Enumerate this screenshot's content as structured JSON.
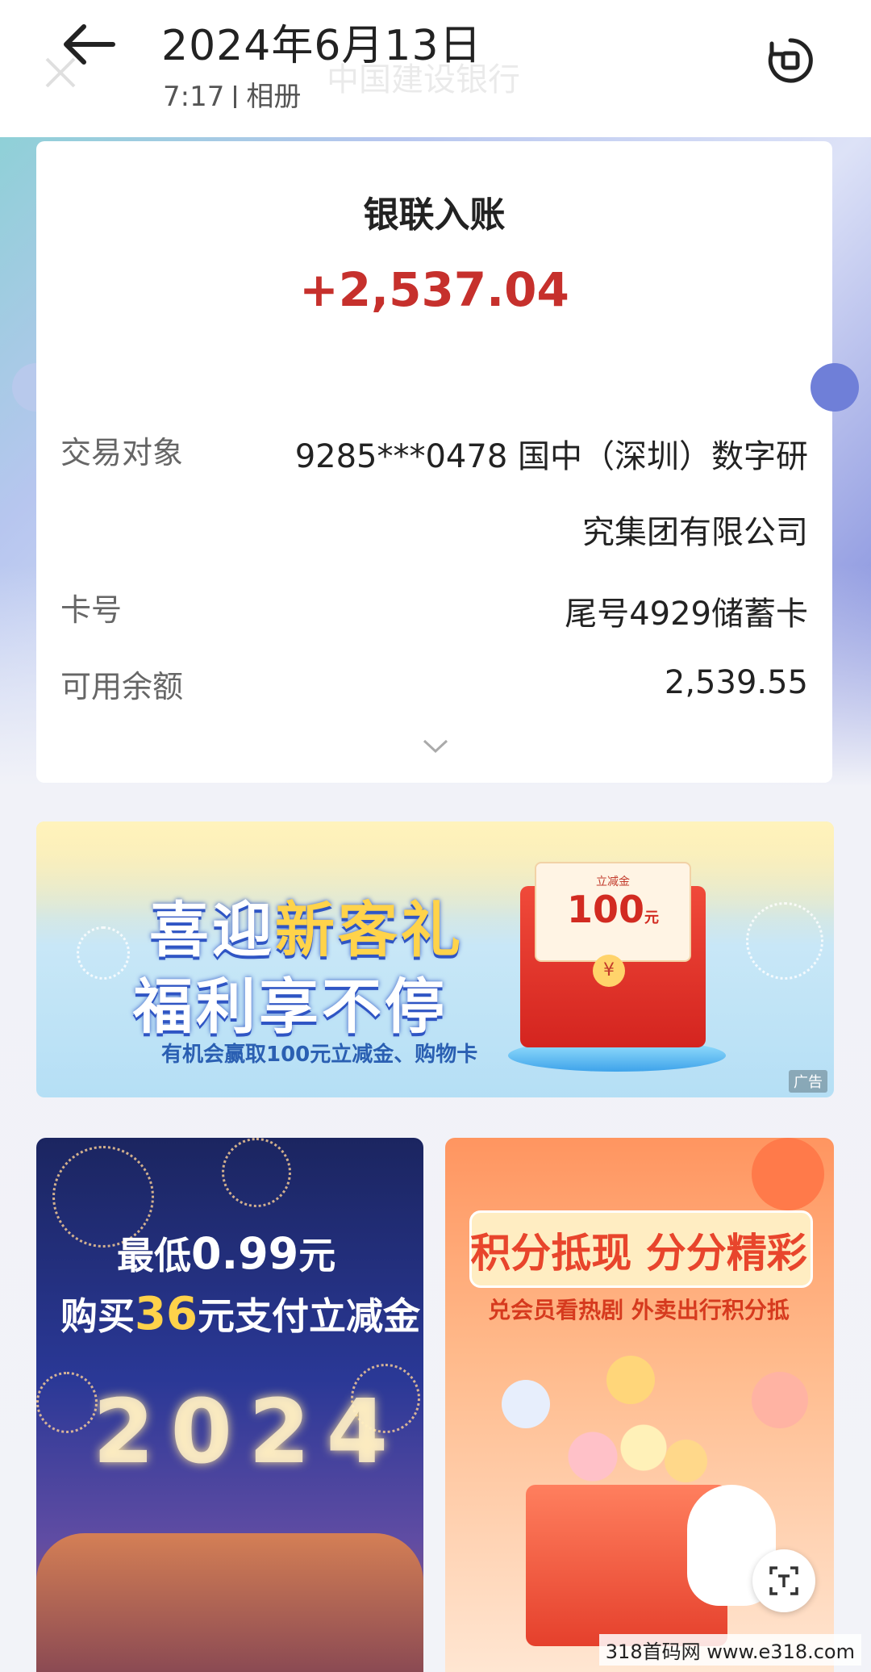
{
  "header": {
    "date_title": "2024年6月13日",
    "time": "7:17",
    "album": "相册",
    "ghost_title": "中国建设银行"
  },
  "receipt": {
    "title": "银联入账",
    "amount": "+2,537.04",
    "rows": [
      {
        "label": "交易对象",
        "value_line1": "9285***0478 国中（深圳）数字研",
        "value_line2": "究集团有限公司"
      },
      {
        "label": "卡号",
        "value": "尾号4929储蓄卡"
      },
      {
        "label": "可用余额",
        "value": "2,539.55"
      }
    ]
  },
  "ad_banner": {
    "line1_a": "喜迎",
    "line1_b": "新客礼",
    "line2": "福利享不停",
    "subtitle": "有机会赢取100元立减金、购物卡",
    "coupon_label": "立减金",
    "coupon_amount": "100",
    "coupon_unit": "元",
    "tag": "广告"
  },
  "card_left": {
    "line1_a": "最低",
    "line1_num": "0.99",
    "line1_b": "元",
    "line2_a": "购买",
    "line2_num": "36",
    "line2_b": "元支付立减金",
    "year": "2024"
  },
  "card_right": {
    "title": "积分抵现 分分精彩",
    "subtitle": "兑会员看热剧 外卖出行积分抵"
  },
  "watermark": "318首码网 www.e318.com",
  "colors": {
    "amount": "#c6302c",
    "accent_blue": "#2f55c4"
  }
}
